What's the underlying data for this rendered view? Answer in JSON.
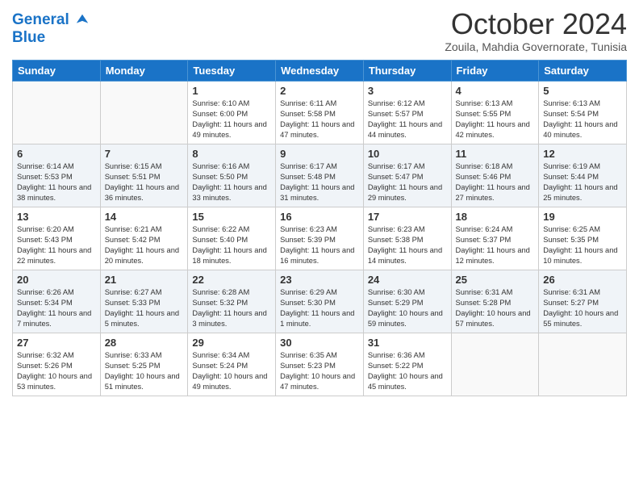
{
  "header": {
    "logo_line1": "General",
    "logo_line2": "Blue",
    "month": "October 2024",
    "location": "Zouila, Mahdia Governorate, Tunisia"
  },
  "days_of_week": [
    "Sunday",
    "Monday",
    "Tuesday",
    "Wednesday",
    "Thursday",
    "Friday",
    "Saturday"
  ],
  "weeks": [
    [
      {
        "day": "",
        "sunrise": "",
        "sunset": "",
        "daylight": ""
      },
      {
        "day": "",
        "sunrise": "",
        "sunset": "",
        "daylight": ""
      },
      {
        "day": "1",
        "sunrise": "Sunrise: 6:10 AM",
        "sunset": "Sunset: 6:00 PM",
        "daylight": "Daylight: 11 hours and 49 minutes."
      },
      {
        "day": "2",
        "sunrise": "Sunrise: 6:11 AM",
        "sunset": "Sunset: 5:58 PM",
        "daylight": "Daylight: 11 hours and 47 minutes."
      },
      {
        "day": "3",
        "sunrise": "Sunrise: 6:12 AM",
        "sunset": "Sunset: 5:57 PM",
        "daylight": "Daylight: 11 hours and 44 minutes."
      },
      {
        "day": "4",
        "sunrise": "Sunrise: 6:13 AM",
        "sunset": "Sunset: 5:55 PM",
        "daylight": "Daylight: 11 hours and 42 minutes."
      },
      {
        "day": "5",
        "sunrise": "Sunrise: 6:13 AM",
        "sunset": "Sunset: 5:54 PM",
        "daylight": "Daylight: 11 hours and 40 minutes."
      }
    ],
    [
      {
        "day": "6",
        "sunrise": "Sunrise: 6:14 AM",
        "sunset": "Sunset: 5:53 PM",
        "daylight": "Daylight: 11 hours and 38 minutes."
      },
      {
        "day": "7",
        "sunrise": "Sunrise: 6:15 AM",
        "sunset": "Sunset: 5:51 PM",
        "daylight": "Daylight: 11 hours and 36 minutes."
      },
      {
        "day": "8",
        "sunrise": "Sunrise: 6:16 AM",
        "sunset": "Sunset: 5:50 PM",
        "daylight": "Daylight: 11 hours and 33 minutes."
      },
      {
        "day": "9",
        "sunrise": "Sunrise: 6:17 AM",
        "sunset": "Sunset: 5:48 PM",
        "daylight": "Daylight: 11 hours and 31 minutes."
      },
      {
        "day": "10",
        "sunrise": "Sunrise: 6:17 AM",
        "sunset": "Sunset: 5:47 PM",
        "daylight": "Daylight: 11 hours and 29 minutes."
      },
      {
        "day": "11",
        "sunrise": "Sunrise: 6:18 AM",
        "sunset": "Sunset: 5:46 PM",
        "daylight": "Daylight: 11 hours and 27 minutes."
      },
      {
        "day": "12",
        "sunrise": "Sunrise: 6:19 AM",
        "sunset": "Sunset: 5:44 PM",
        "daylight": "Daylight: 11 hours and 25 minutes."
      }
    ],
    [
      {
        "day": "13",
        "sunrise": "Sunrise: 6:20 AM",
        "sunset": "Sunset: 5:43 PM",
        "daylight": "Daylight: 11 hours and 22 minutes."
      },
      {
        "day": "14",
        "sunrise": "Sunrise: 6:21 AM",
        "sunset": "Sunset: 5:42 PM",
        "daylight": "Daylight: 11 hours and 20 minutes."
      },
      {
        "day": "15",
        "sunrise": "Sunrise: 6:22 AM",
        "sunset": "Sunset: 5:40 PM",
        "daylight": "Daylight: 11 hours and 18 minutes."
      },
      {
        "day": "16",
        "sunrise": "Sunrise: 6:23 AM",
        "sunset": "Sunset: 5:39 PM",
        "daylight": "Daylight: 11 hours and 16 minutes."
      },
      {
        "day": "17",
        "sunrise": "Sunrise: 6:23 AM",
        "sunset": "Sunset: 5:38 PM",
        "daylight": "Daylight: 11 hours and 14 minutes."
      },
      {
        "day": "18",
        "sunrise": "Sunrise: 6:24 AM",
        "sunset": "Sunset: 5:37 PM",
        "daylight": "Daylight: 11 hours and 12 minutes."
      },
      {
        "day": "19",
        "sunrise": "Sunrise: 6:25 AM",
        "sunset": "Sunset: 5:35 PM",
        "daylight": "Daylight: 11 hours and 10 minutes."
      }
    ],
    [
      {
        "day": "20",
        "sunrise": "Sunrise: 6:26 AM",
        "sunset": "Sunset: 5:34 PM",
        "daylight": "Daylight: 11 hours and 7 minutes."
      },
      {
        "day": "21",
        "sunrise": "Sunrise: 6:27 AM",
        "sunset": "Sunset: 5:33 PM",
        "daylight": "Daylight: 11 hours and 5 minutes."
      },
      {
        "day": "22",
        "sunrise": "Sunrise: 6:28 AM",
        "sunset": "Sunset: 5:32 PM",
        "daylight": "Daylight: 11 hours and 3 minutes."
      },
      {
        "day": "23",
        "sunrise": "Sunrise: 6:29 AM",
        "sunset": "Sunset: 5:30 PM",
        "daylight": "Daylight: 11 hours and 1 minute."
      },
      {
        "day": "24",
        "sunrise": "Sunrise: 6:30 AM",
        "sunset": "Sunset: 5:29 PM",
        "daylight": "Daylight: 10 hours and 59 minutes."
      },
      {
        "day": "25",
        "sunrise": "Sunrise: 6:31 AM",
        "sunset": "Sunset: 5:28 PM",
        "daylight": "Daylight: 10 hours and 57 minutes."
      },
      {
        "day": "26",
        "sunrise": "Sunrise: 6:31 AM",
        "sunset": "Sunset: 5:27 PM",
        "daylight": "Daylight: 10 hours and 55 minutes."
      }
    ],
    [
      {
        "day": "27",
        "sunrise": "Sunrise: 6:32 AM",
        "sunset": "Sunset: 5:26 PM",
        "daylight": "Daylight: 10 hours and 53 minutes."
      },
      {
        "day": "28",
        "sunrise": "Sunrise: 6:33 AM",
        "sunset": "Sunset: 5:25 PM",
        "daylight": "Daylight: 10 hours and 51 minutes."
      },
      {
        "day": "29",
        "sunrise": "Sunrise: 6:34 AM",
        "sunset": "Sunset: 5:24 PM",
        "daylight": "Daylight: 10 hours and 49 minutes."
      },
      {
        "day": "30",
        "sunrise": "Sunrise: 6:35 AM",
        "sunset": "Sunset: 5:23 PM",
        "daylight": "Daylight: 10 hours and 47 minutes."
      },
      {
        "day": "31",
        "sunrise": "Sunrise: 6:36 AM",
        "sunset": "Sunset: 5:22 PM",
        "daylight": "Daylight: 10 hours and 45 minutes."
      },
      {
        "day": "",
        "sunrise": "",
        "sunset": "",
        "daylight": ""
      },
      {
        "day": "",
        "sunrise": "",
        "sunset": "",
        "daylight": ""
      }
    ]
  ]
}
